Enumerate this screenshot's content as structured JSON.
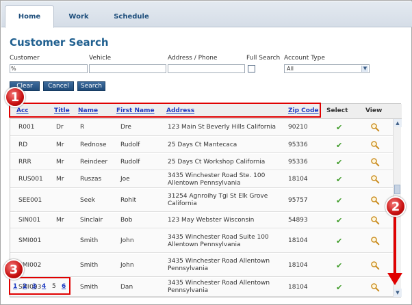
{
  "tabs": [
    "Home",
    "Work",
    "Schedule"
  ],
  "page_title": "Customer Search",
  "filters": {
    "customer_label": "Customer",
    "customer_value": "%",
    "vehicle_label": "Vehicle",
    "vehicle_value": "",
    "address_label": "Address / Phone",
    "address_value": "",
    "fullsearch_label": "Full Search",
    "account_type_label": "Account Type",
    "account_type_value": "All"
  },
  "buttons": {
    "clear": "Clear",
    "cancel": "Cancel",
    "search": "Search"
  },
  "columns": {
    "acc": "Acc",
    "title": "Title",
    "name": "Name",
    "first_name": "First Name",
    "address": "Address",
    "zip": "Zip Code",
    "select": "Select",
    "view": "View"
  },
  "rows": [
    {
      "acc": "R001",
      "title": "Dr",
      "name": "R",
      "first": "Dre",
      "address1": "123 Main St Beverly Hills California",
      "address2": "",
      "zip": "90210"
    },
    {
      "acc": "RD",
      "title": "Mr",
      "name": "Rednose",
      "first": "Rudolf",
      "address1": "25 Days Ct Mantecaca",
      "address2": "",
      "zip": "95336"
    },
    {
      "acc": "RRR",
      "title": "Mr",
      "name": "Reindeer",
      "first": "Rudolf",
      "address1": "25 Days Ct Workshop California",
      "address2": "",
      "zip": "95336"
    },
    {
      "acc": "RUS001",
      "title": "Mr",
      "name": "Ruszas",
      "first": "Joe",
      "address1": "3435 Winchester Road Ste. 100",
      "address2": "Allentown Pennsylvania",
      "zip": "18104"
    },
    {
      "acc": "SEE001",
      "title": "",
      "name": "Seek",
      "first": "Rohit",
      "address1": "31254 Agnroihy Tgi St Elk Grove",
      "address2": "California",
      "zip": "95757"
    },
    {
      "acc": "SIN001",
      "title": "Mr",
      "name": "Sinclair",
      "first": "Bob",
      "address1": "123 May Webster Wisconsin",
      "address2": "",
      "zip": "54893"
    },
    {
      "acc": "SMI001",
      "title": "",
      "name": "Smith",
      "first": "John",
      "address1": "3435 Winchester Road Suite 100",
      "address2": "Allentown Pennsylvania",
      "zip": "18104"
    },
    {
      "acc": "SMI002",
      "title": "",
      "name": "Smith",
      "first": "John",
      "address1": "3435 Winchester Road Allentown",
      "address2": "Pennsylvania",
      "zip": "18104"
    },
    {
      "acc": "SMI003",
      "title": "",
      "name": "Smith",
      "first": "Dan",
      "address1": "3435 Winchester Road Allentown",
      "address2": "Pennsylvania",
      "zip": "18104"
    }
  ],
  "pager": {
    "pages": [
      "1",
      "2",
      "3",
      "4",
      "5",
      "6"
    ],
    "current": "5"
  },
  "markers": [
    "1",
    "2",
    "3"
  ],
  "colors": {
    "accent": "#1f5f8f",
    "highlight": "#e00000",
    "link": "#1d3ac2",
    "check": "#3c9a25"
  },
  "icons": {
    "select": "check-icon",
    "view": "magnifier-icon",
    "scroll_up": "chevron-up-icon",
    "scroll_down": "chevron-down-icon"
  }
}
